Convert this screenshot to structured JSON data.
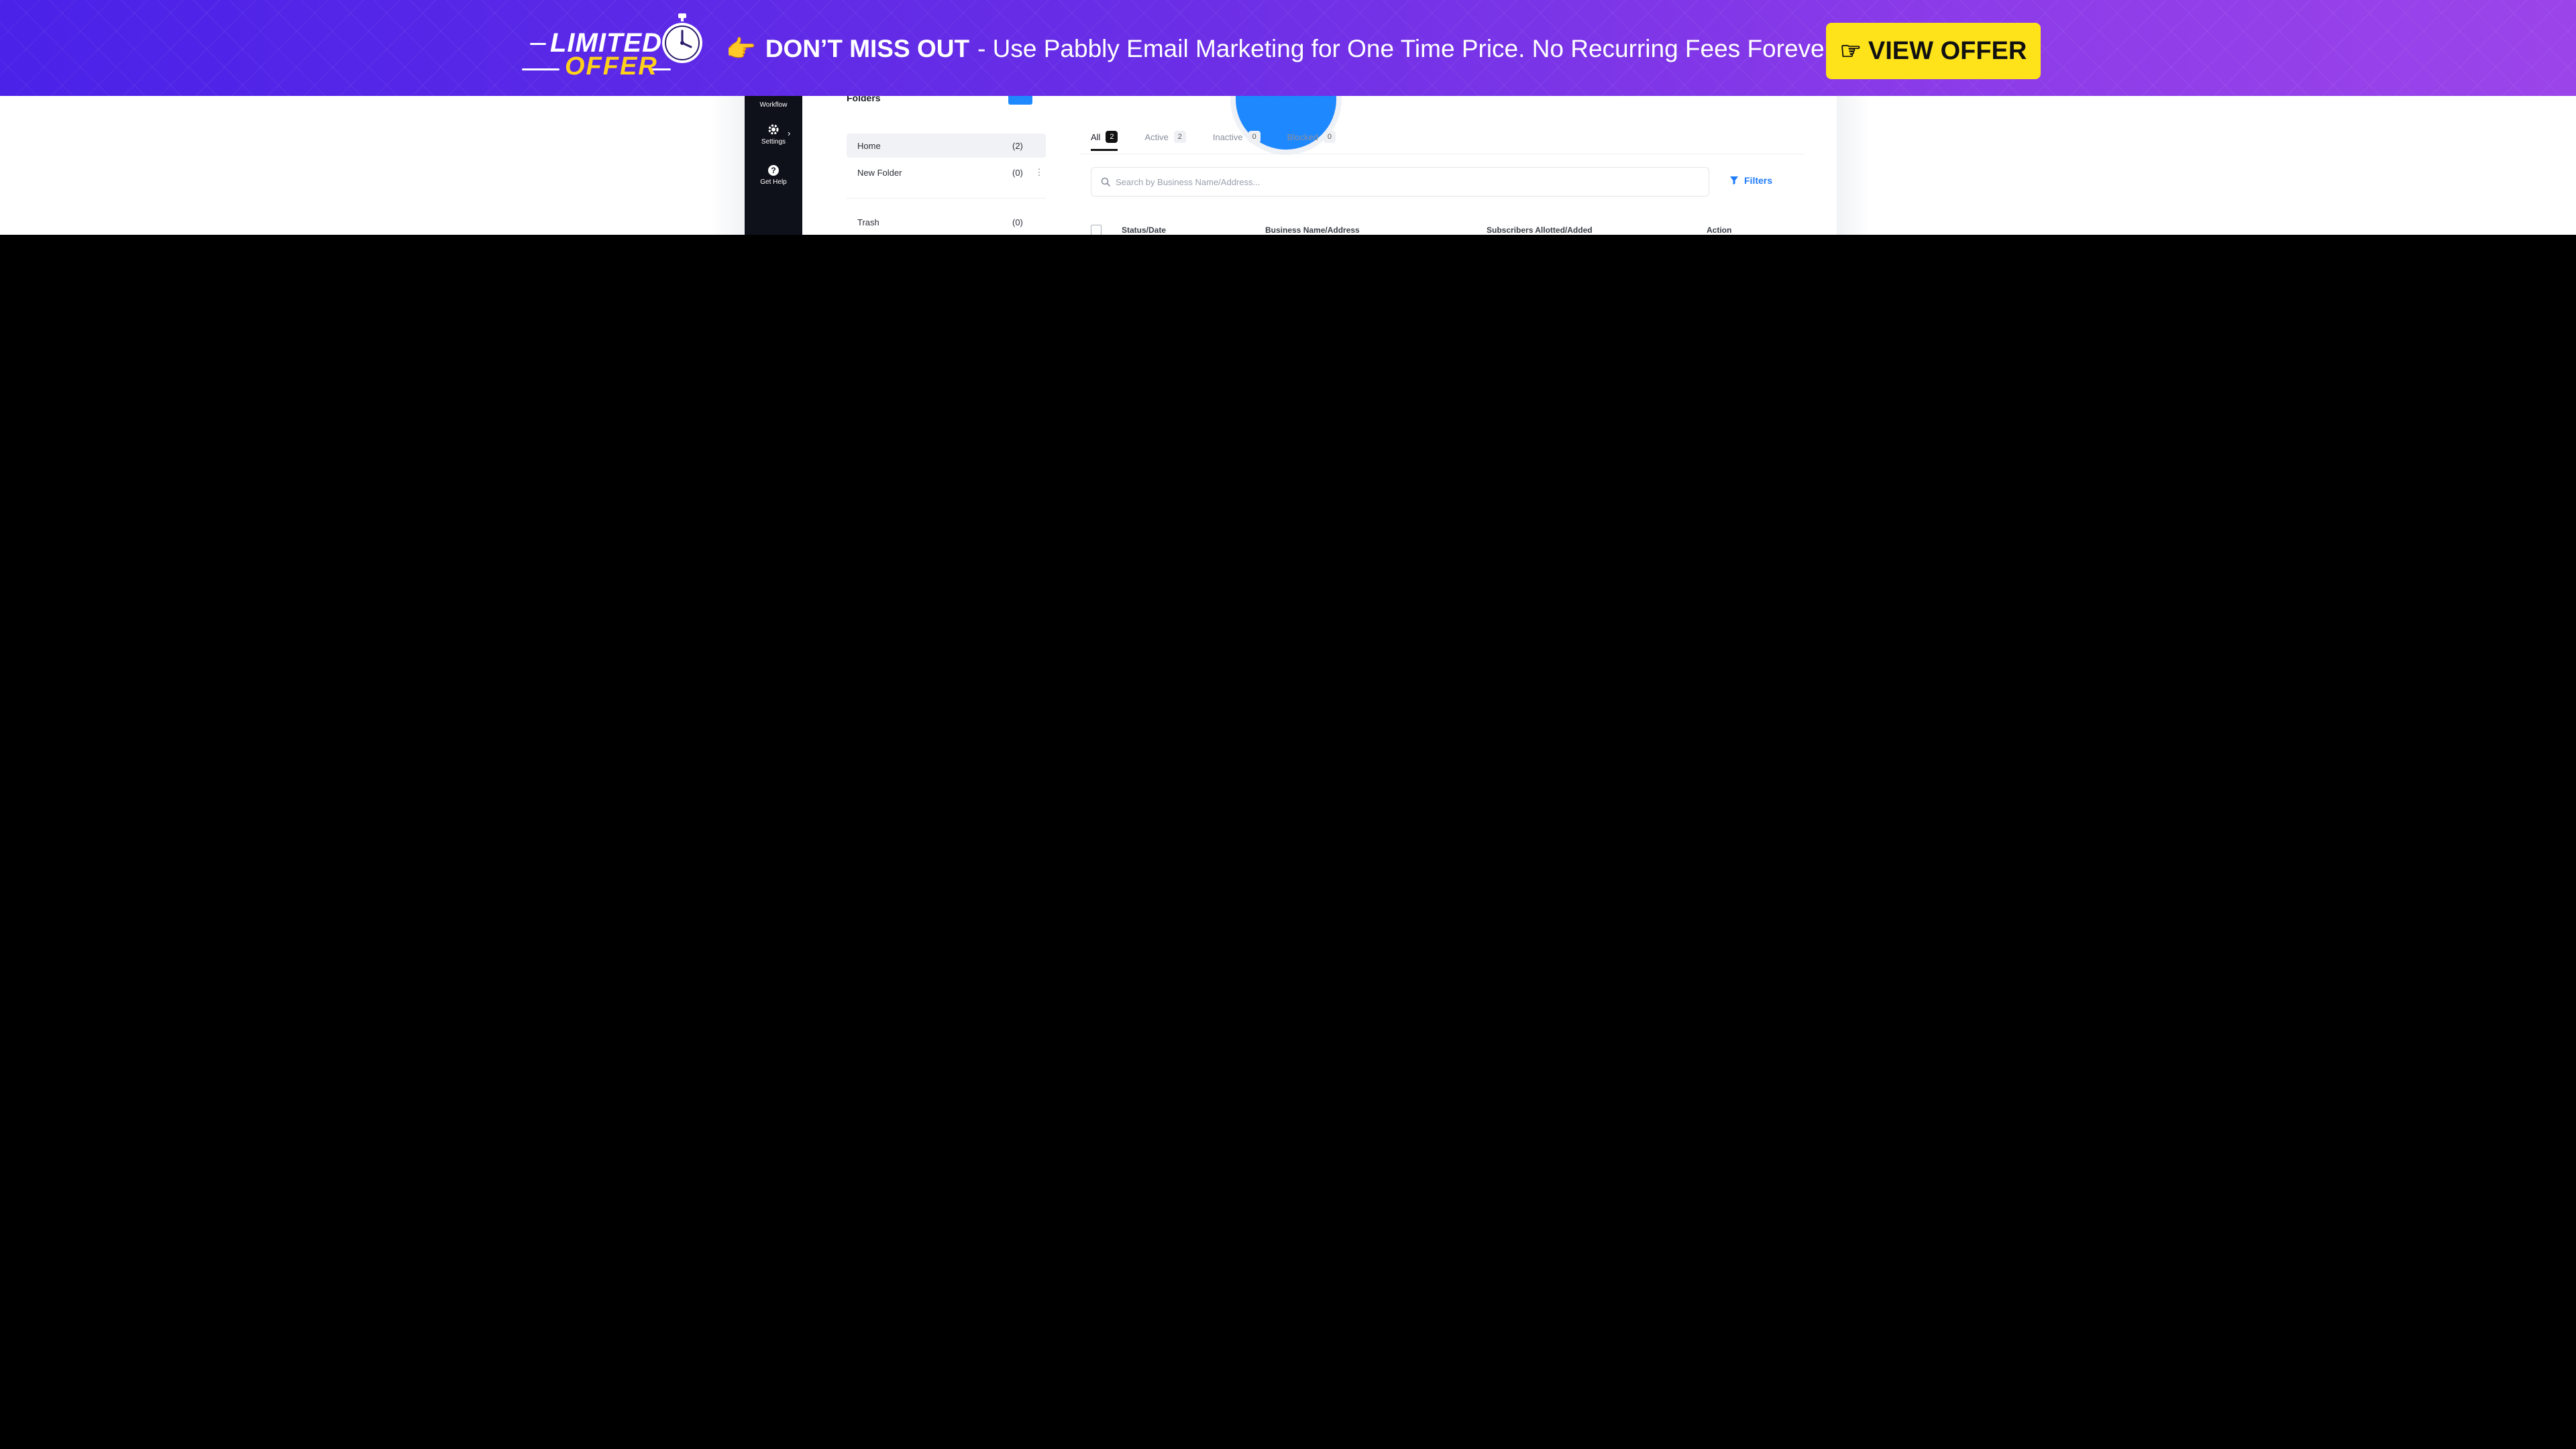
{
  "banner": {
    "logo_limited": "LIMITED",
    "logo_offer": "OFFER",
    "headline_bold": "DON’T MISS OUT",
    "headline_rest": "- Use Pabbly Email Marketing for One Time Price. No Recurring Fees Forever.",
    "cta_label": "VIEW OFFER",
    "colors": {
      "gradient_start": "#4a22e8",
      "gradient_end": "#9b44ea",
      "cta_bg": "#ffe31a",
      "logo_accent": "#ffd11a"
    }
  },
  "sidebar": {
    "items": [
      {
        "label": "Workflow",
        "icon": "workflow-icon"
      },
      {
        "label": "Settings",
        "icon": "gear-icon"
      },
      {
        "label": "Get Help",
        "icon": "help-icon"
      }
    ]
  },
  "folders": {
    "title": "Folders",
    "items": [
      {
        "name": "Home",
        "count": "(2)"
      },
      {
        "name": "New Folder",
        "count": "(0)"
      },
      {
        "name": "Trash",
        "count": "(0)"
      }
    ]
  },
  "main": {
    "tabs": [
      {
        "label": "All",
        "count": "2"
      },
      {
        "label": "Active",
        "count": "2"
      },
      {
        "label": "Inactive",
        "count": "0"
      },
      {
        "label": "Blocked",
        "count": "0"
      }
    ],
    "search_placeholder": "Search by  Business Name/Address...",
    "filters_label": "Filters",
    "columns": [
      "Status/Date",
      "Business Name/Address",
      "Subscribers Allotted/Added",
      "Action"
    ],
    "accent": "#1e88ff"
  }
}
